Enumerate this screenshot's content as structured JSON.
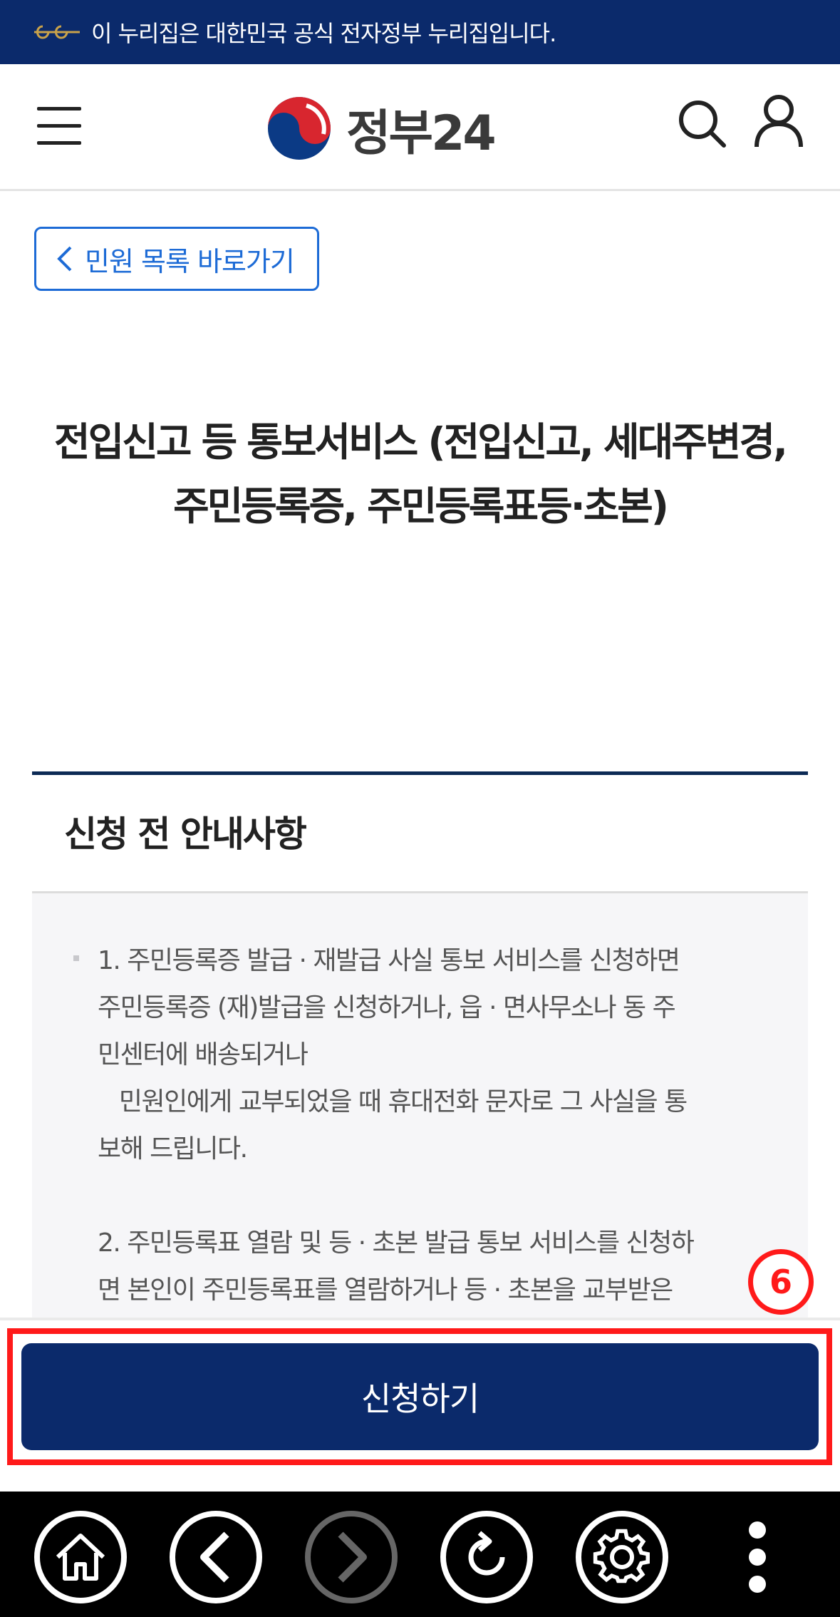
{
  "gov_banner": {
    "text": "이 누리집은 대한민국 공식 전자정부 누리집입니다."
  },
  "header": {
    "logo_text": "정부24",
    "menu_icon": "hamburger-menu-icon",
    "search_icon": "search-icon",
    "user_icon": "user-icon"
  },
  "back_link": {
    "label": "민원 목록 바로가기",
    "icon": "chevron-left-icon"
  },
  "title": {
    "line1": "전입신고 등 통보서비스 (전입신고, 세대주변경,",
    "line2": "주민등록증, 주민등록표등·초본)"
  },
  "notice": {
    "heading": "신청 전 안내사항",
    "lines": [
      "1. 주민등록증 발급 · 재발급 사실 통보 서비스를 신청하면",
      "주민등록증 (재)발급을 신청하거나, 읍 · 면사무소나 동 주",
      "민센터에 배송되거나",
      "   민원인에게 교부되었을 때 휴대전화 문자로 그 사실을 통",
      "보해 드립니다.",
      "2. 주민등록표 열람 및 등 · 초본 발급 통보 서비스를 신청하",
      "면 본인이 주민등록표를 열람하거나 등 · 초본을 교부받은"
    ]
  },
  "apply_button": {
    "label": "신청하기"
  },
  "annotation": {
    "step_number": "6",
    "color": "#ff1a1a"
  },
  "navbar": {
    "home_icon": "home-icon",
    "back_icon": "back-arrow-icon",
    "forward_icon": "forward-arrow-icon",
    "reload_icon": "reload-icon",
    "settings_icon": "gear-icon",
    "more_icon": "more-vertical-icon"
  },
  "colors": {
    "brand_navy": "#0b2a6b",
    "link_blue": "#1d6bd6",
    "divider_navy": "#0c2a55",
    "notice_bg": "#f6f6f8"
  }
}
